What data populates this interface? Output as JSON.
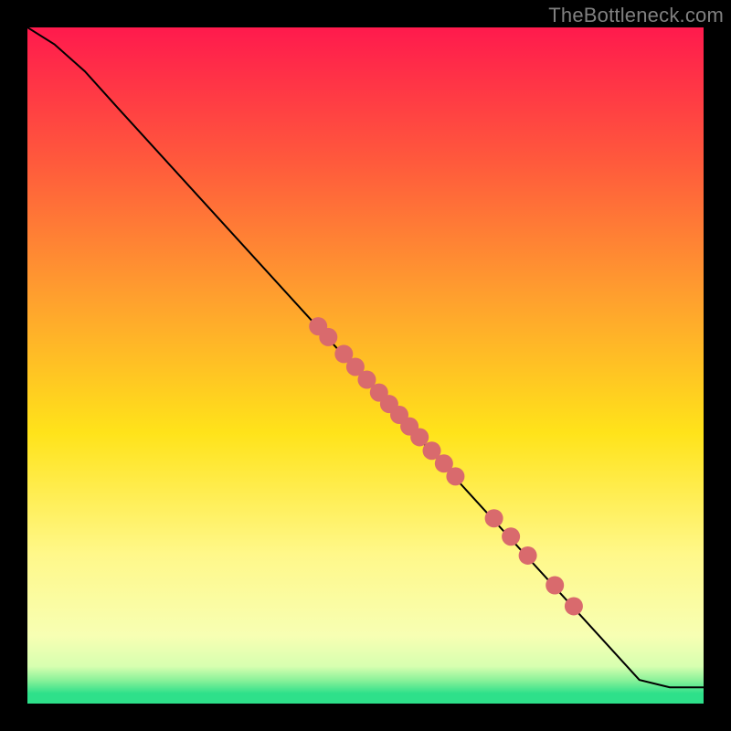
{
  "watermark": "TheBottleneck.com",
  "chart_data": {
    "type": "line",
    "title": "",
    "xlabel": "",
    "ylabel": "",
    "xlim": [
      0,
      1
    ],
    "ylim": [
      0,
      1
    ],
    "gradient_background": {
      "description": "Vertical gradient on plot area: red at top through orange, yellow, pale-yellow, thin green band at very bottom",
      "stops": [
        {
          "offset": 0.0,
          "color": "#ff1a4d"
        },
        {
          "offset": 0.2,
          "color": "#ff5a3c"
        },
        {
          "offset": 0.4,
          "color": "#ffa02e"
        },
        {
          "offset": 0.6,
          "color": "#ffe31a"
        },
        {
          "offset": 0.78,
          "color": "#fff88a"
        },
        {
          "offset": 0.9,
          "color": "#f7ffb3"
        },
        {
          "offset": 0.945,
          "color": "#d7ffb0"
        },
        {
          "offset": 0.965,
          "color": "#8cf29a"
        },
        {
          "offset": 0.985,
          "color": "#2ee08a"
        },
        {
          "offset": 1.0,
          "color": "#2ee08a"
        }
      ]
    },
    "series": [
      {
        "name": "bottleneck-curve",
        "color": "#000000",
        "stroke_width": 2,
        "points_xy": [
          [
            0.0,
            1.0
          ],
          [
            0.04,
            0.975
          ],
          [
            0.085,
            0.935
          ],
          [
            0.13,
            0.885
          ],
          [
            0.905,
            0.035
          ],
          [
            0.95,
            0.024
          ],
          [
            1.0,
            0.024
          ]
        ]
      }
    ],
    "scatter": {
      "name": "datapoints",
      "color": "#d96a6d",
      "radius": 10,
      "points_xy": [
        [
          0.43,
          0.558
        ],
        [
          0.445,
          0.542
        ],
        [
          0.468,
          0.517
        ],
        [
          0.485,
          0.498
        ],
        [
          0.502,
          0.479
        ],
        [
          0.52,
          0.46
        ],
        [
          0.535,
          0.443
        ],
        [
          0.55,
          0.427
        ],
        [
          0.565,
          0.41
        ],
        [
          0.58,
          0.394
        ],
        [
          0.598,
          0.374
        ],
        [
          0.616,
          0.355
        ],
        [
          0.633,
          0.336
        ],
        [
          0.69,
          0.274
        ],
        [
          0.715,
          0.247
        ],
        [
          0.74,
          0.219
        ],
        [
          0.78,
          0.175
        ],
        [
          0.808,
          0.144
        ]
      ]
    }
  }
}
